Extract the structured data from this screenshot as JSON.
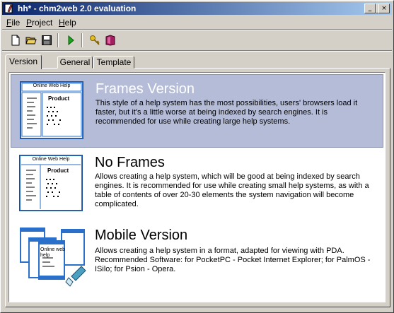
{
  "window": {
    "title": "hh* - chm2web 2.0 evaluation",
    "controls": {
      "minimize": "_",
      "maximize": "□",
      "close": "×"
    }
  },
  "menubar": {
    "items": [
      {
        "accel": "F",
        "rest": "ile"
      },
      {
        "accel": "P",
        "rest": "roject"
      },
      {
        "accel": "H",
        "rest": "elp"
      }
    ]
  },
  "toolbar": {
    "icons": [
      "new-document-icon",
      "open-folder-icon",
      "save-icon",
      "run-icon",
      "key-icon",
      "help-book-icon"
    ]
  },
  "tabs": [
    {
      "label": "Version",
      "active": true
    },
    {
      "label": "General",
      "active": false
    },
    {
      "label": "Template",
      "active": false
    }
  ],
  "options": [
    {
      "title": "Frames Version",
      "description": "This style of a help system has the most possibilities, users' browsers load it faster, but it's a little worse at being indexed by search engines. It is recommended for use while creating large help systems.",
      "selected": true,
      "preview_header": "Online Web Help",
      "preview_product": "Product"
    },
    {
      "title": "No Frames",
      "description": "Allows creating a help system, which will be good at being indexed by search engines. It is recommended for use while creating small help systems, as with a table of contents of over 20-30 elements the system navigation will become complicated.",
      "selected": false,
      "preview_header": "Online Web Help",
      "preview_product": "Product"
    },
    {
      "title": "Mobile Version",
      "description": "Allows creating a help system in a format, adapted for viewing with PDA. Recommended Software: for PocketPC - Pocket Internet Explorer; for PalmOS - ISilo; for Psion - Opera.",
      "selected": false,
      "preview_header": "Online web help",
      "preview_product": ""
    }
  ]
}
